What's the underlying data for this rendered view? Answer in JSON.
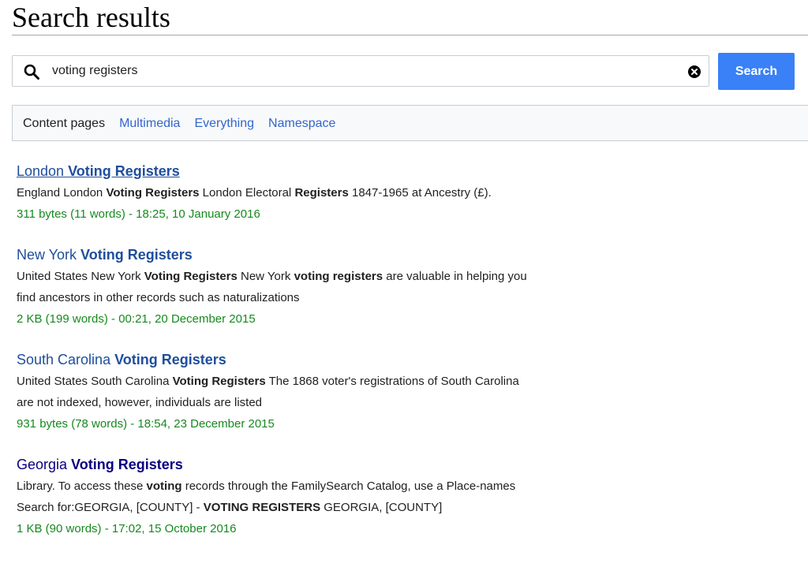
{
  "header": {
    "title": "Search results"
  },
  "search": {
    "value": "voting registers",
    "button_label": "Search"
  },
  "profiles": [
    {
      "label": "Content pages",
      "active": true
    },
    {
      "label": "Multimedia",
      "active": false
    },
    {
      "label": "Everything",
      "active": false
    },
    {
      "label": "Namespace",
      "active": false
    }
  ],
  "results": [
    {
      "title_plain": "London ",
      "title_bold": "Voting Registers",
      "snippet": [
        {
          "t": "England London "
        },
        {
          "t": "Voting Registers",
          "b": true
        },
        {
          "t": " London Electoral "
        },
        {
          "t": "Registers",
          "b": true
        },
        {
          "t": " 1847-1965 at Ancestry (£)."
        }
      ],
      "meta": "311 bytes (11 words) - 18:25, 10 January 2016"
    },
    {
      "title_plain": "New York ",
      "title_bold": "Voting Registers",
      "snippet": [
        {
          "t": "United States New York "
        },
        {
          "t": "Voting Registers",
          "b": true
        },
        {
          "t": " New York "
        },
        {
          "t": "voting registers",
          "b": true
        },
        {
          "t": " are valuable in helping you find ancestors in other records such as naturalizations"
        }
      ],
      "meta": "2 KB (199 words) - 00:21, 20 December 2015"
    },
    {
      "title_plain": "South Carolina ",
      "title_bold": "Voting Registers",
      "snippet": [
        {
          "t": "United States South Carolina "
        },
        {
          "t": "Voting Registers",
          "b": true
        },
        {
          "t": " The 1868 voter's registrations of South Carolina are not indexed, however, individuals are listed"
        }
      ],
      "meta": "931 bytes (78 words) - 18:54, 23 December 2015"
    },
    {
      "title_plain": "Georgia ",
      "title_bold": "Voting Registers",
      "snippet": [
        {
          "t": "Library. To access these "
        },
        {
          "t": "voting",
          "b": true
        },
        {
          "t": " records through the FamilySearch Catalog, use a Place-names Search for:GEORGIA, [COUNTY] - "
        },
        {
          "t": "VOTING REGISTERS",
          "b": true
        },
        {
          "t": " GEORGIA, [COUNTY]"
        }
      ],
      "meta": "1 KB (90 words) - 17:02, 15 October 2016"
    }
  ],
  "icons": {
    "search": "search-icon",
    "clear": "clear-icon"
  },
  "colors": {
    "link": "#1f4e9c",
    "visited": "#0b0080",
    "meta": "#16891e",
    "button": "#3a80f6"
  }
}
